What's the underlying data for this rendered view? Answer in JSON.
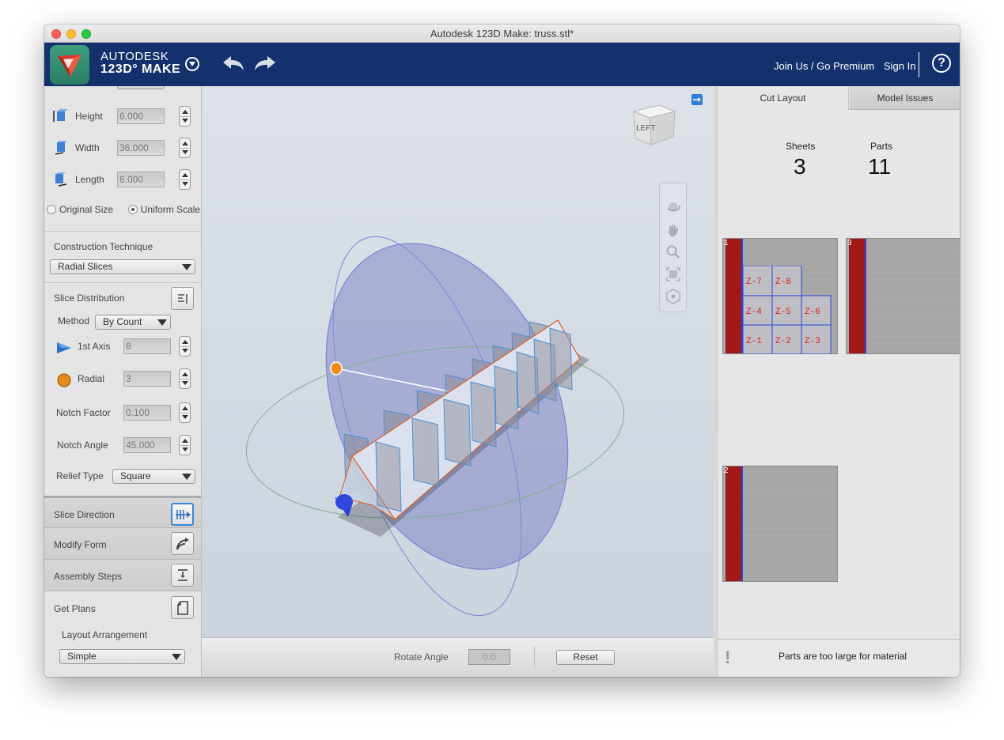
{
  "window": {
    "title": "Autodesk 123D Make: truss.stl*"
  },
  "app": {
    "brand_line1": "AUTODESK",
    "brand_line2": "123D° MAKE",
    "join_label": "Join Us / Go Premium",
    "signin_label": "Sign In",
    "help_label": "?"
  },
  "dimensions": {
    "height": {
      "label": "Height",
      "value": "6.000"
    },
    "width": {
      "label": "Width",
      "value": "36.000"
    },
    "length": {
      "label": "Length",
      "value": "6.000"
    },
    "original_size_label": "Original Size",
    "uniform_scale_label": "Uniform Scale",
    "uniform_scale_selected": true
  },
  "construction": {
    "title": "Construction Technique",
    "technique": "Radial Slices"
  },
  "slice_distribution": {
    "title": "Slice Distribution",
    "method_label": "Method",
    "method_value": "By Count",
    "first_axis_label": "1st Axis",
    "first_axis_value": "8",
    "radial_label": "Radial",
    "radial_value": "3",
    "notch_factor_label": "Notch Factor",
    "notch_factor_value": "0.100",
    "notch_angle_label": "Notch Angle",
    "notch_angle_value": "45.000",
    "relief_type_label": "Relief Type",
    "relief_type_value": "Square"
  },
  "steps": {
    "slice_direction": "Slice Direction",
    "modify_form": "Modify Form",
    "assembly_steps": "Assembly Steps",
    "get_plans": "Get Plans",
    "layout_arrangement_label": "Layout Arrangement",
    "layout_arrangement_value": "Simple"
  },
  "viewport": {
    "viewcube_face": "LEFT",
    "rotate_label": "Rotate Angle",
    "rotate_value": "0.0",
    "reset_label": "Reset"
  },
  "right_panel": {
    "tabs": [
      "Cut Layout",
      "Model Issues"
    ],
    "sheets_label": "Sheets",
    "sheets_value": "3",
    "parts_label": "Parts",
    "parts_value": "11",
    "sheet_numbers": [
      "1",
      "3",
      "2"
    ],
    "part_labels": [
      "Z-7",
      "Z-8",
      "Z-4",
      "Z-5",
      "Z-6",
      "Z-1",
      "Z-2",
      "Z-3"
    ],
    "status_icon": "!",
    "status_text": "Parts are too large for material"
  },
  "colors": {
    "appbar": "#14316d",
    "sheet_strip": "#a01818",
    "part_outline": "#2a43d8",
    "part_label": "#e01b1b",
    "accent": "#2d7ed6"
  },
  "icons": [
    "logo-icon",
    "dropdown-icon",
    "undo-icon",
    "redo-icon",
    "help-icon",
    "height-icon",
    "width-icon",
    "length-icon",
    "list-icon",
    "first-axis-icon",
    "radial-icon",
    "slice-direction-icon",
    "modify-form-icon",
    "assembly-steps-icon",
    "get-plans-icon",
    "orbit-icon",
    "pan-icon",
    "zoom-icon",
    "fit-icon",
    "home-view-icon",
    "expand-icon",
    "warning-icon"
  ]
}
